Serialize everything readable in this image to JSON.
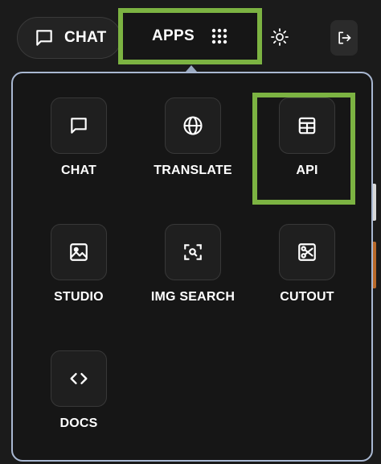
{
  "header": {
    "chat_label": "CHAT",
    "apps_label": "APPS",
    "icons": {
      "chat": "chat-bubble-icon",
      "apps": "grid-dots-icon",
      "theme": "sun-icon",
      "logout": "logout-icon"
    }
  },
  "apps_menu": {
    "items": [
      {
        "label": "CHAT",
        "icon": "chat-bubble-icon"
      },
      {
        "label": "TRANSLATE",
        "icon": "globe-icon"
      },
      {
        "label": "API",
        "icon": "table-icon",
        "highlighted": true
      },
      {
        "label": "STUDIO",
        "icon": "image-icon"
      },
      {
        "label": "IMG SEARCH",
        "icon": "image-search-icon"
      },
      {
        "label": "CUTOUT",
        "icon": "scissors-icon"
      },
      {
        "label": "DOCS",
        "icon": "code-icon"
      }
    ]
  },
  "colors": {
    "highlight": "#7cb342",
    "panel_border": "#a9b8d2",
    "background": "#1b1b1b"
  }
}
